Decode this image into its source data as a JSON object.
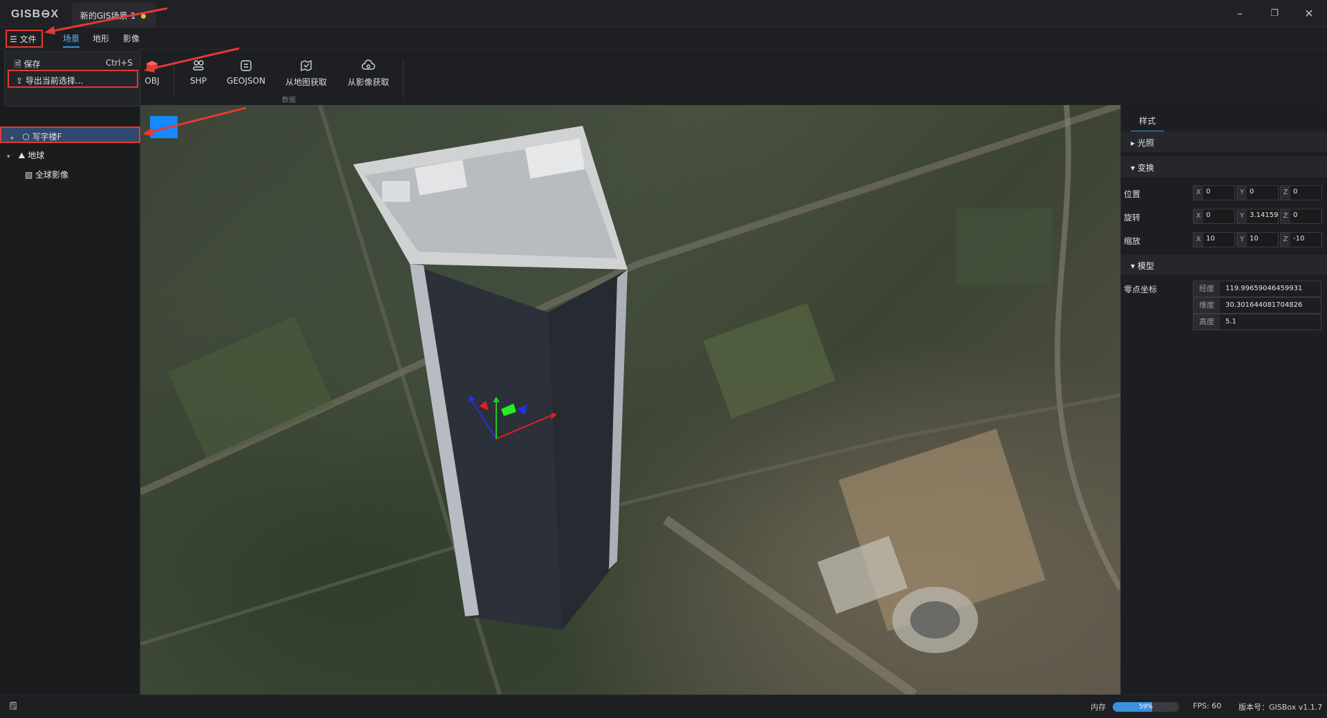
{
  "app": {
    "logo": "GISB⊖X",
    "doc_tab": "新的GIS场景-1",
    "window_controls": [
      "minimize-icon",
      "restore-icon",
      "close-icon"
    ]
  },
  "menubar": {
    "file_label": "文件",
    "tabs": [
      "场景",
      "地形",
      "影像"
    ],
    "active_tab": "场景"
  },
  "ribbon": {
    "buttons": [
      {
        "label": "OBJ",
        "icon": "cube-icon"
      },
      {
        "label": "SHP",
        "icon": "shape-icon"
      },
      {
        "label": "GEOJSON",
        "icon": "geojson-icon"
      },
      {
        "label": "从地图获取",
        "icon": "map-fetch-icon"
      },
      {
        "label": "从影像获取",
        "icon": "image-fetch-icon"
      }
    ],
    "group_label": "数据"
  },
  "file_menu": {
    "save_label": "保存",
    "save_shortcut": "Ctrl+S",
    "export_label": "导出当前选择..."
  },
  "tree": {
    "building": "写字楼F",
    "earth": "地球",
    "imagery": "全球影像"
  },
  "properties": {
    "tab": "样式",
    "sections": {
      "lighting": "光照",
      "transform": "变换",
      "model": "模型"
    },
    "position_label": "位置",
    "rotation_label": "旋转",
    "scale_label": "缩放",
    "axes": [
      "X",
      "Y",
      "Z"
    ],
    "position": [
      "0",
      "0",
      "0"
    ],
    "rotation": [
      "0",
      "3.14159",
      "0"
    ],
    "scale": [
      "10",
      "10",
      "-10"
    ],
    "origin_label": "零点坐标",
    "lon_label": "经度",
    "lon_value": "119.99659046459931",
    "lat_label": "维度",
    "lat_value": "30.301644081704826",
    "height_label": "高度",
    "height_value": "5.1"
  },
  "status": {
    "memory_label": "内存",
    "memory_percent": "59%",
    "memory_fraction": 0.59,
    "fps": "FPS: 60",
    "version": "版本号：GISBox v1.1.7"
  },
  "colors": {
    "accent": "#2f96e8",
    "highlight_red": "#e53935",
    "selection": "#31476b"
  }
}
